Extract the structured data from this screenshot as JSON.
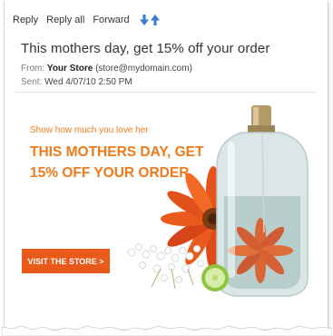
{
  "toolbar": {
    "reply": "Reply",
    "reply_all": "Reply all",
    "forward": "Forward",
    "prev_icon": "arrow-down-icon",
    "next_icon": "arrow-up-icon"
  },
  "email": {
    "subject": "This mothers day, get 15% off your order",
    "from_label": "From:",
    "from_name": "Your Store",
    "from_address": "(store@mydomain.com)",
    "sent_label": "Sent:",
    "sent_value": "Wed 4/07/10 2:50 PM"
  },
  "ad": {
    "tagline": "Show how much you love her",
    "headline_line1": "THIS MOTHERS DAY, GET",
    "headline_line2": "15% OFF YOUR ORDER",
    "cta": "VISIT THE STORE >"
  },
  "colors": {
    "accent": "#f07a1a",
    "button": "#e8591a",
    "nav_arrow": "#3a7bd5"
  }
}
